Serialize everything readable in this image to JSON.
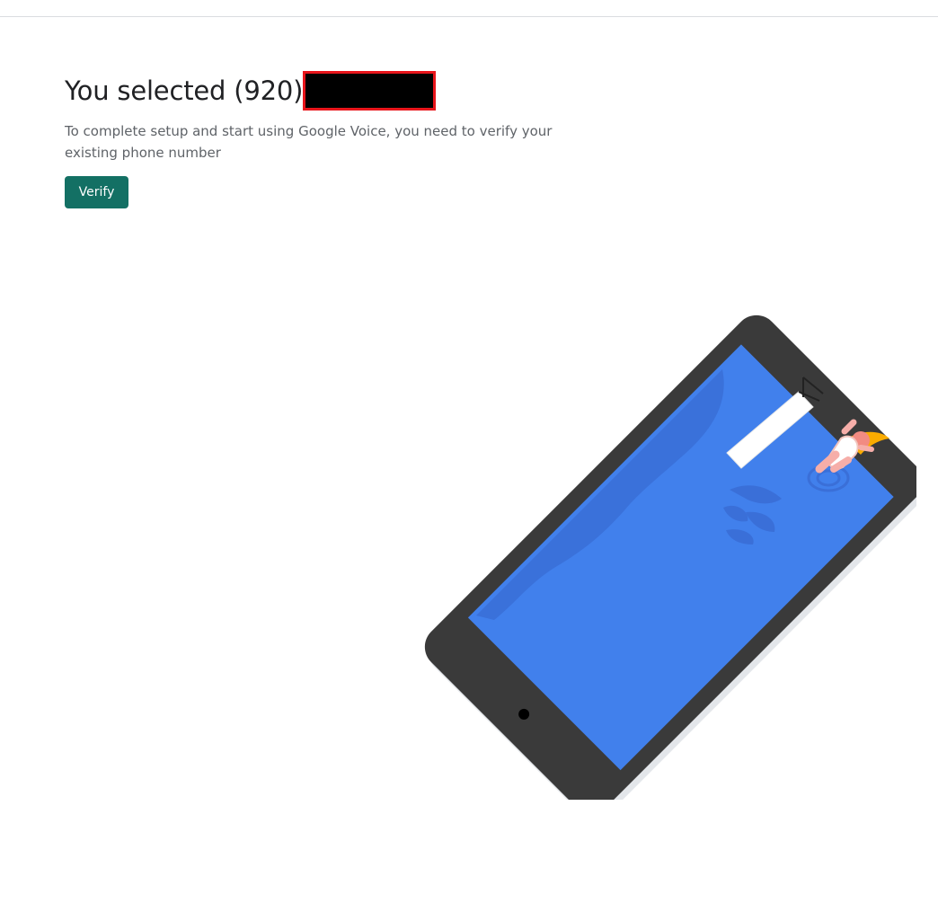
{
  "header": {
    "title_prefix": "You selected (920)"
  },
  "main": {
    "description": "To complete setup and start using Google Voice, you need to verify your existing phone number",
    "verify_label": "Verify"
  },
  "colors": {
    "button": "#137064",
    "redaction_border": "#e8151b",
    "phone_body": "#3a3a3a",
    "phone_screen": "#4180ec"
  },
  "icons": {
    "illustration": "phone-pool-swimmer-illustration"
  }
}
